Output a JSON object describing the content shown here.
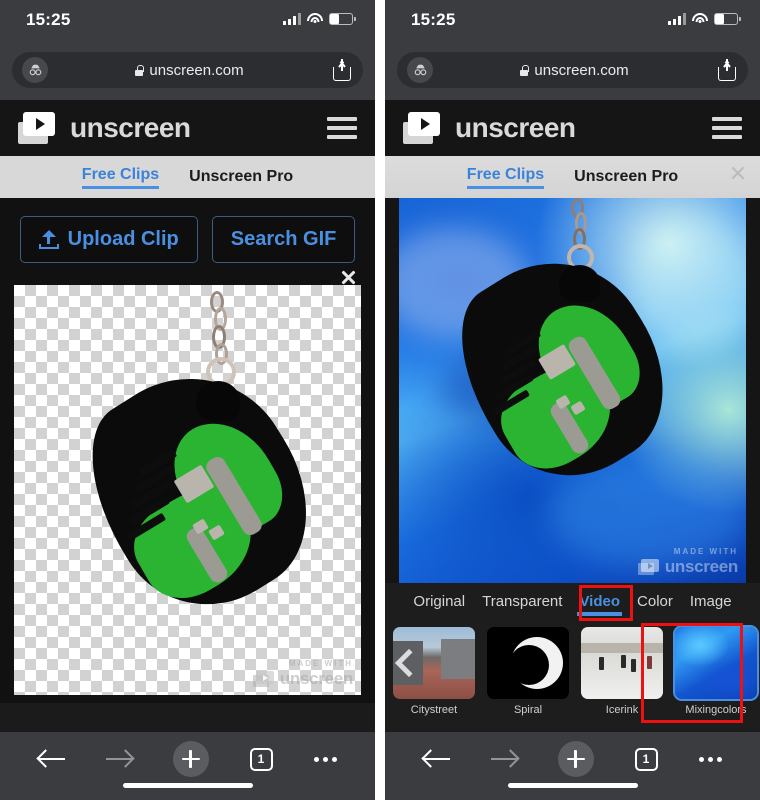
{
  "status": {
    "time": "15:25",
    "signal_icon": "cellular-signal-icon",
    "wifi_icon": "wifi-icon",
    "battery_icon": "battery-icon"
  },
  "browser": {
    "incognito_icon": "incognito-icon",
    "lock_icon": "lock-icon",
    "url": "unscreen.com",
    "share_icon": "share-icon",
    "bottom": {
      "back_icon": "back-arrow-icon",
      "forward_icon": "forward-arrow-icon",
      "new_tab_icon": "plus-icon",
      "tab_count": "1",
      "more_icon": "more-options-icon"
    }
  },
  "site": {
    "logo_icon": "unscreen-logo-icon",
    "brand": "unscreen",
    "menu_icon": "hamburger-menu-icon",
    "tabs": [
      {
        "label": "Free Clips",
        "active": true
      },
      {
        "label": "Unscreen Pro",
        "active": false
      }
    ],
    "close_icon": "close-icon"
  },
  "left_panel": {
    "buttons": [
      {
        "label": "Upload Clip",
        "icon": "upload-icon"
      },
      {
        "label": "Search GIF",
        "icon": null
      }
    ],
    "result_close_icon": "close-icon",
    "preview": {
      "background": "transparent-checkerboard",
      "subject": "green-sneaker-keychain"
    },
    "watermark": {
      "made_with": "MADE WITH",
      "brand": "unscreen"
    }
  },
  "right_panel": {
    "preview": {
      "background": "mixingcolors-video",
      "subject": "green-sneaker-keychain"
    },
    "watermark": {
      "made_with": "MADE WITH",
      "brand": "unscreen"
    },
    "bg_tabs": [
      {
        "label": "Original",
        "active": false
      },
      {
        "label": "Transparent",
        "active": false
      },
      {
        "label": "Video",
        "active": true,
        "highlighted": true
      },
      {
        "label": "Color",
        "active": false
      },
      {
        "label": "Image",
        "active": false
      }
    ],
    "carousel": {
      "prev_icon": "chevron-left-icon",
      "next_icon": "chevron-right-icon",
      "items": [
        {
          "label": "Citystreet",
          "selected": false
        },
        {
          "label": "Spiral",
          "selected": false
        },
        {
          "label": "Icerink",
          "selected": false
        },
        {
          "label": "Mixingcolors",
          "selected": true,
          "highlighted": true
        },
        {
          "label": "",
          "selected": false
        }
      ]
    }
  },
  "colors": {
    "accent_blue": "#4a90e2",
    "annotation_red": "#ee1111",
    "chrome_grey": "#3a3c40",
    "site_dark": "#151515"
  }
}
